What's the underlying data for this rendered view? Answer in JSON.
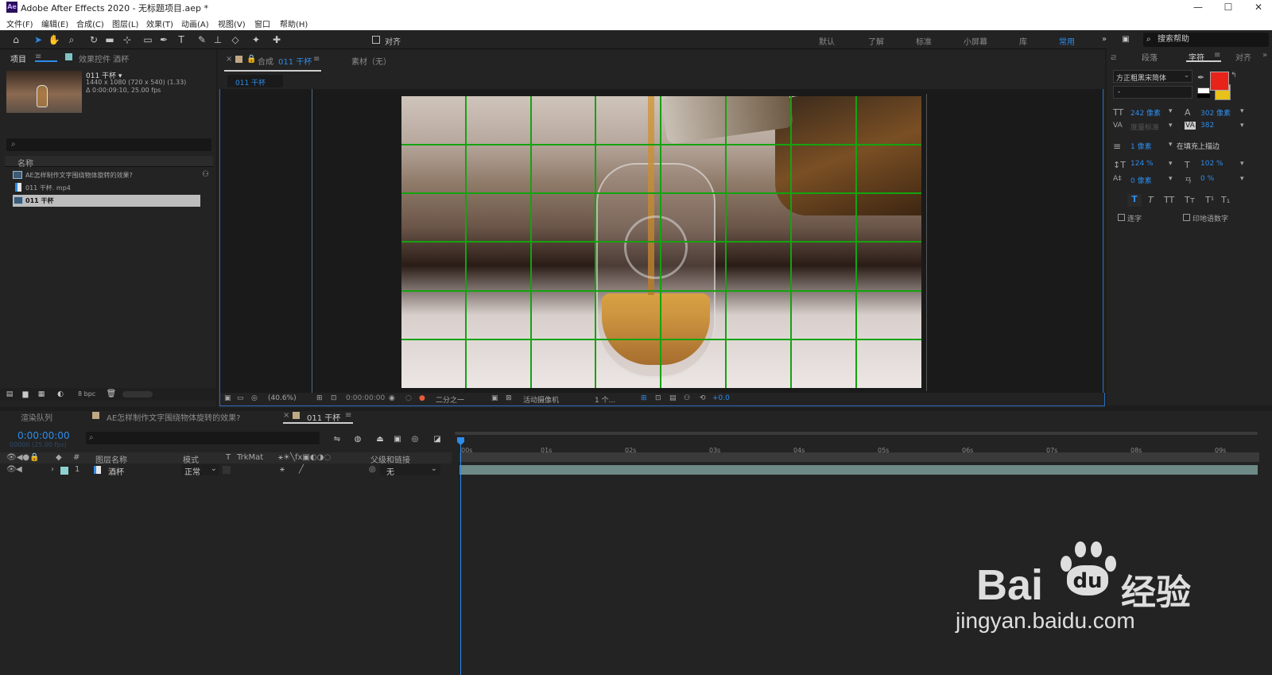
{
  "window": {
    "title": "Adobe After Effects 2020 - 无标题项目.aep *",
    "app_badge": "Ae",
    "minimize": "—",
    "maximize": "☐",
    "close": "✕"
  },
  "menu": [
    "文件(F)",
    "编辑(E)",
    "合成(C)",
    "图层(L)",
    "效果(T)",
    "动画(A)",
    "视图(V)",
    "窗口",
    "帮助(H)"
  ],
  "toolbar": {
    "snap_label": "对齐",
    "workspaces": [
      "默认",
      "了解",
      "标准",
      "小屏幕",
      "库"
    ],
    "workspace_active": "常用",
    "overflow": "»",
    "help_placeholder": "搜索帮助"
  },
  "project_panel": {
    "tab_project": "项目",
    "tab_effects": "效果控件 酒杯",
    "comp_name": "011 干杯 ▾",
    "comp_info1": "1440 x 1080  (720 x 540) (1.33)",
    "comp_info2": "Δ 0:00:09:10, 25.00 fps",
    "col_name": "名称",
    "items": [
      "AE怎样制作文字围绕物体旋转的效果?",
      "011 干杯. mp4",
      "011 干杯"
    ],
    "bpc": "8 bpc"
  },
  "comp_panel": {
    "tab_comp_prefix": "合成",
    "tab_comp_name": "011 干杯",
    "tab_footage": "素材（无）",
    "subtab": "011 干杯",
    "zoom": "(40.6%)",
    "timecode": "0:00:00:00",
    "resolution": "二分之一",
    "camera": "活动摄像机",
    "views": "1 个...",
    "exposure": "+0.0"
  },
  "char_panel": {
    "tab_para": "段落",
    "tab_char": "字符",
    "tab_align": "对齐",
    "font": "方正粗黑宋简体",
    "style": "-",
    "font_size": "242 像素",
    "leading": "302 像素",
    "kerning": "度量标准",
    "tracking": "382",
    "stroke": "1 像素",
    "stroke_type": "在填充上描边",
    "vscale": "124 %",
    "hscale": "102 %",
    "baseline": "0 像素",
    "tsume": "0 %",
    "ligature": "连字",
    "hindi": "印地语数字",
    "fill_color": "#e8231a"
  },
  "timeline": {
    "tab_render": "渲染队列",
    "tab_comp1": "AE怎样制作文字围绕物体旋转的效果?",
    "tab_comp2": "011 干杯",
    "timecode": "0:00:00:00",
    "frames": "00000 (25.00 fps)",
    "col_num": "#",
    "col_layer": "图层名称",
    "col_mode": "模式",
    "col_t": "T",
    "col_trkmat": "TrkMat",
    "col_parent": "父级和链接",
    "layer_num": "1",
    "layer_name": "酒杯",
    "layer_mode": "正常",
    "layer_parent": "无",
    "ticks": [
      "00s",
      "01s",
      "02s",
      "03s",
      "04s",
      "05s",
      "06s",
      "07s",
      "08s",
      "09s"
    ]
  },
  "watermark": {
    "brand": "Bai",
    "brand2": "du",
    "cn": "经验",
    "url": "jingyan.baidu.com"
  }
}
